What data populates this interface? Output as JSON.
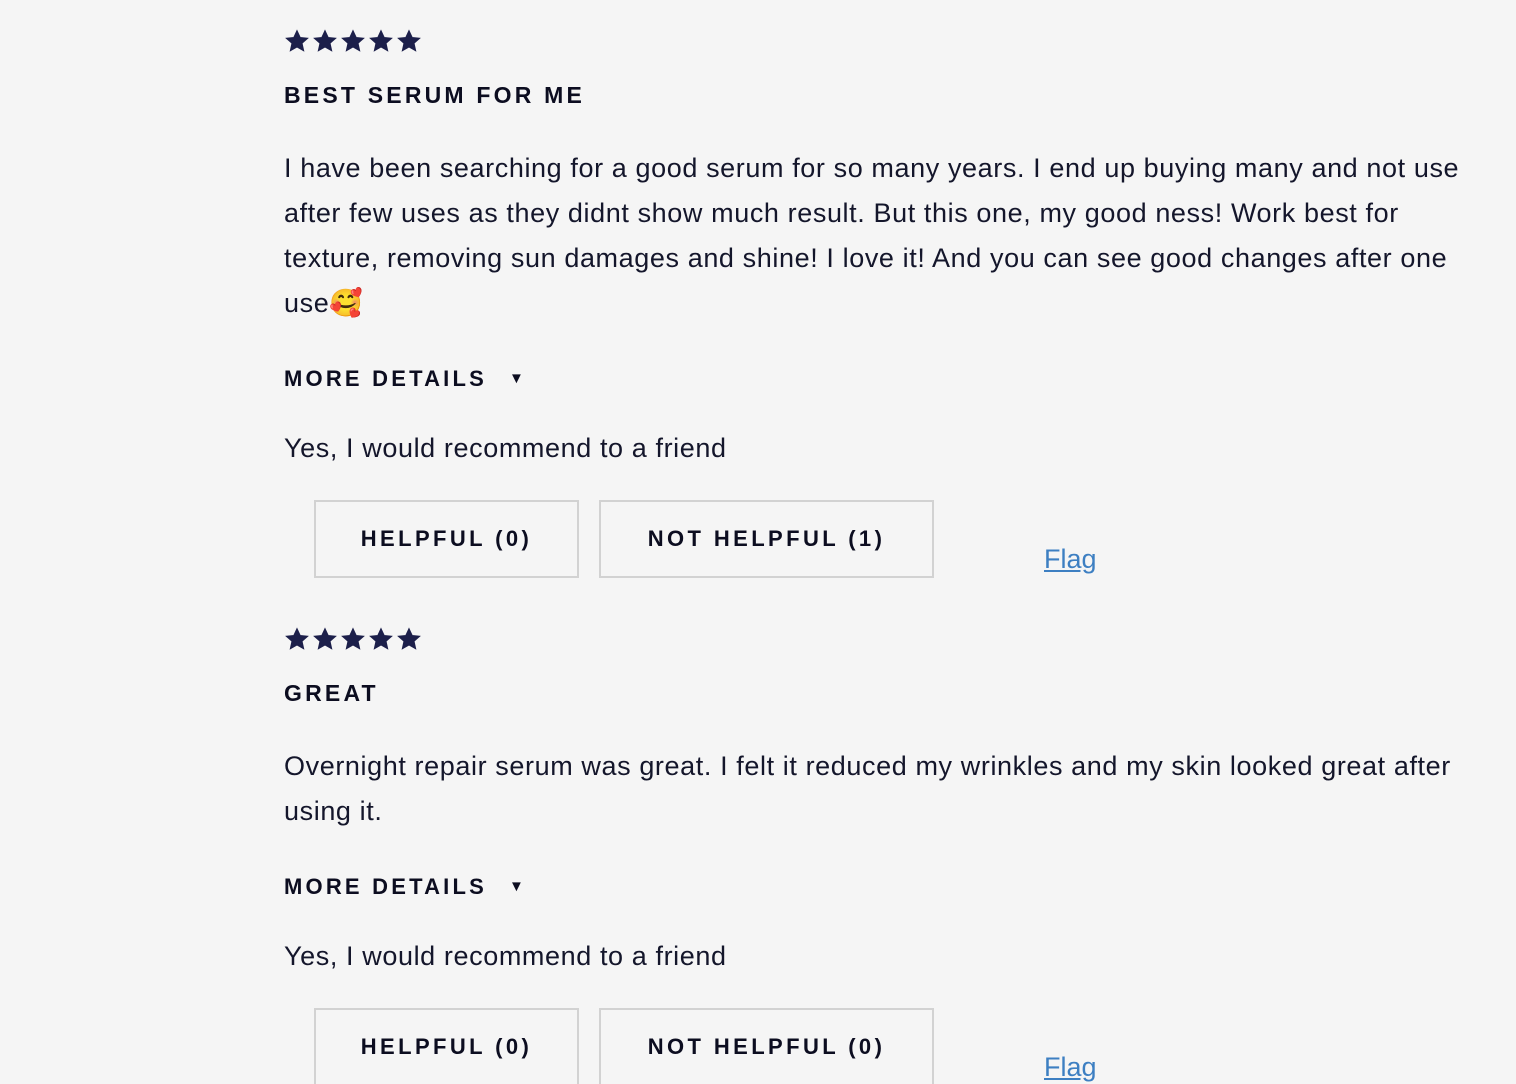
{
  "reviews": [
    {
      "rating": 5,
      "rating_max": 5,
      "star_color": "#1c1f4a",
      "title": "BEST SERUM FOR ME",
      "body": "I have been searching for a good serum for so many years. I end up buying many and not use after few uses as they didnt show much result. But this one, my good ness! Work best for texture, removing sun damages and shine! I love it! And you can see good changes after one use🥰",
      "more_details_label": "MORE DETAILS",
      "more_details_caret": "▼",
      "recommend_text": "Yes, I would recommend to a friend",
      "helpful_label": "HELPFUL (0)",
      "not_helpful_label": "NOT HELPFUL (1)",
      "flag_label": "Flag"
    },
    {
      "rating": 5,
      "rating_max": 5,
      "star_color": "#1c1f4a",
      "title": "GREAT",
      "body": "Overnight repair serum was great. I felt it reduced my wrinkles and my skin looked great after using it.",
      "more_details_label": "MORE DETAILS",
      "more_details_caret": "▼",
      "recommend_text": "Yes, I would recommend to a friend",
      "helpful_label": "HELPFUL (0)",
      "not_helpful_label": "NOT HELPFUL (0)",
      "flag_label": "Flag"
    }
  ],
  "colors": {
    "background": "#f5f5f5",
    "text": "#14162b",
    "link": "#3d7fc2",
    "button_border": "#d2d2d2"
  }
}
